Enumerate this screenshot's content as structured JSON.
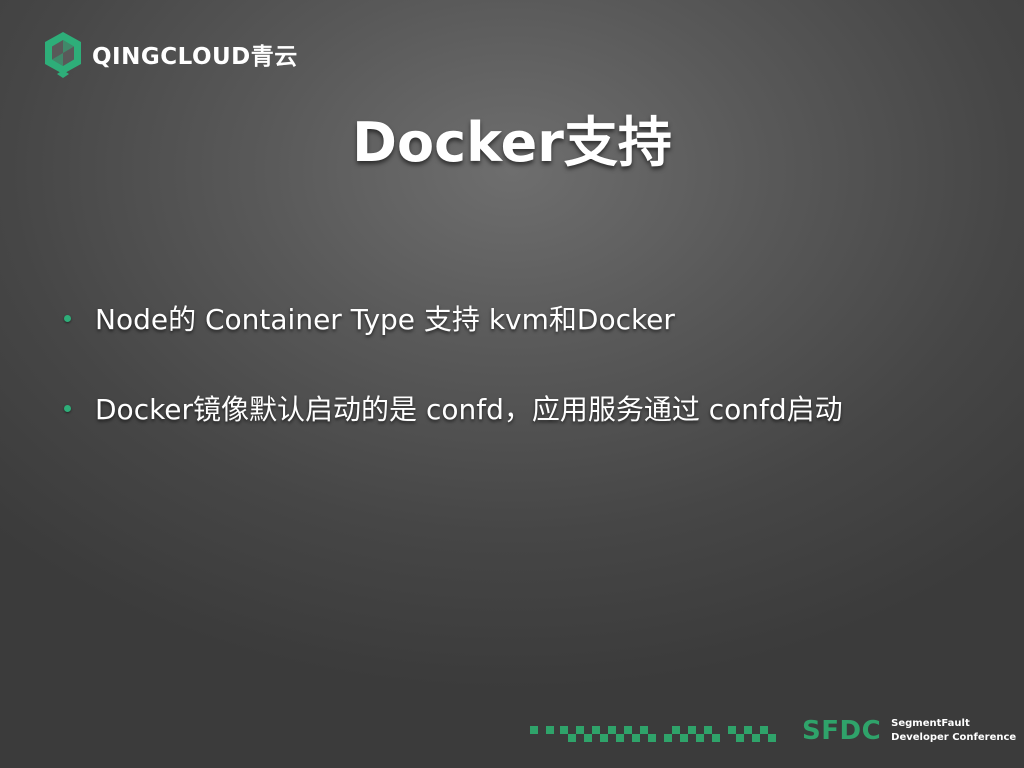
{
  "logo": {
    "name": "QINGCLOUD青云",
    "icon": "qingcloud-hexagon-icon",
    "color": "#2eae79"
  },
  "slide": {
    "title": "Docker支持",
    "bullets": [
      {
        "text": "Node的 Container Type 支持 kvm和Docker"
      },
      {
        "text": "Docker镜像默认启动的是 confd，应用服务通过 confd启动"
      }
    ],
    "bullet_color": "#2eae79"
  },
  "footer": {
    "brand_mark": "SFDC",
    "brand_line1": "SegmentFault",
    "brand_line2": "Developer Conference",
    "brand_color": "#2fa36a",
    "decoration": "green-pixel-pattern"
  }
}
